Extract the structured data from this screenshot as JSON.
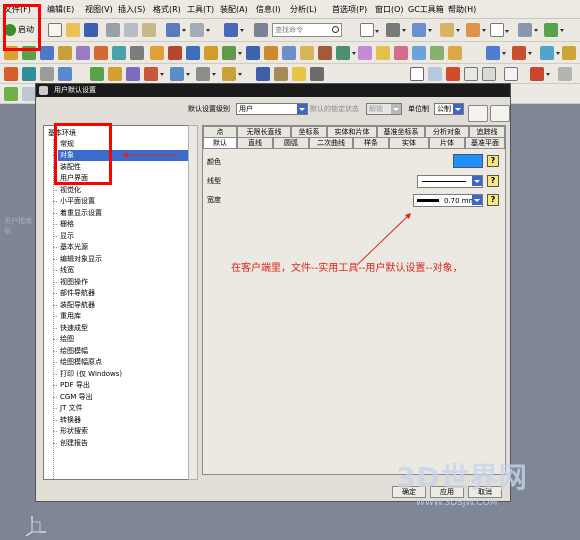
{
  "menubar": {
    "items": [
      "文件(F)",
      "编辑(E)",
      "视图(V)",
      "插入(S)",
      "格式(R)",
      "工具(T)",
      "装配(A)",
      "信息(I)",
      "分析(L)",
      "首选项(P)",
      "窗口(O)",
      "GC工具箱",
      "帮助(H)"
    ]
  },
  "toolbar": {
    "start_label": "启动",
    "search_placeholder": "查找命令"
  },
  "background_text": "用户指南组",
  "dialog": {
    "title": "用户默认设置",
    "level_label": "默认设置级别",
    "level_value": "用户",
    "lock_label": "默认的锁定状态",
    "lock_value": "解锁",
    "unit_label": "单位制",
    "unit_value": "公制",
    "tree": [
      "基本环境",
      "常规",
      "对象",
      "装配性",
      "用户界面",
      "视觉化",
      "小平面设置",
      "着重显示设置",
      "栅格",
      "显示",
      "基本光源",
      "编辑对象显示",
      "线宽",
      "视图操作",
      "部件导航器",
      "装配导航器",
      "重用库",
      "快速成型",
      "绘图",
      "绘图模幅",
      "绘图模幅原点",
      "打印 (仅 Windows)",
      "PDF 导出",
      "CGM 导出",
      "JT 文件",
      "转换器",
      "形状搜索",
      "创建报告"
    ],
    "tabs_row1": [
      "点",
      "无限长直线",
      "坐标系",
      "实体和片体",
      "基准坐标系",
      "分析对象",
      "追踪线"
    ],
    "tabs_row2": [
      "默认",
      "直线",
      "圆弧",
      "二次曲线",
      "样条",
      "实体",
      "片体",
      "基准平面"
    ],
    "props": {
      "color_label": "颜色",
      "color_value": "#1e90ff",
      "linetype_label": "线型",
      "width_label": "宽度",
      "width_value": "0.70 mm"
    },
    "help_glyph": "?",
    "annotation": "在客户端里，文件--实用工具--用户默认设置--对象，",
    "buttons": [
      "确定",
      "应用",
      "取消"
    ]
  },
  "watermark": {
    "text": "3D世界网",
    "url": "WWW.3DSJW.COM"
  }
}
